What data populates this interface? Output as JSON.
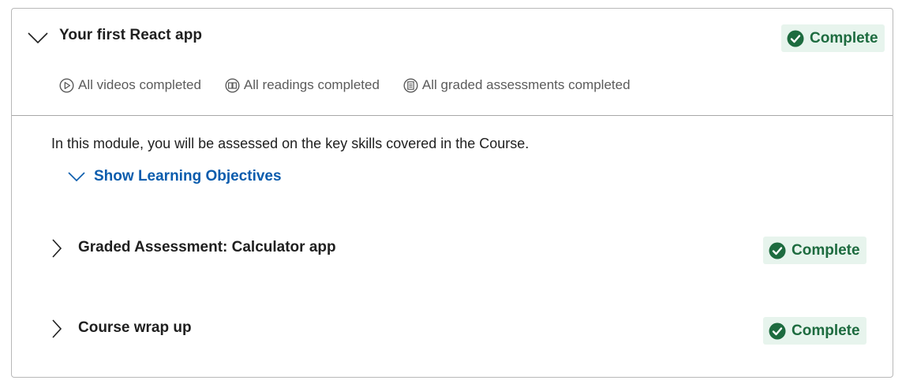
{
  "module": {
    "title": "Your first React app",
    "status": "Complete",
    "progress": [
      {
        "icon": "play-circle-icon",
        "label": "All videos completed"
      },
      {
        "icon": "book-circle-icon",
        "label": "All readings completed"
      },
      {
        "icon": "document-circle-icon",
        "label": "All graded assessments completed"
      }
    ],
    "description": "In this module, you will be assessed on the key skills covered in the Course.",
    "objectives_label": "Show Learning Objectives"
  },
  "items": [
    {
      "title": "Graded Assessment: Calculator app",
      "status": "Complete"
    },
    {
      "title": "Course wrap up",
      "status": "Complete"
    }
  ],
  "colors": {
    "complete_bg": "#e7f4ed",
    "complete_text": "#1d6b3f",
    "link": "#0b5cad",
    "border": "#b8b8b8"
  }
}
